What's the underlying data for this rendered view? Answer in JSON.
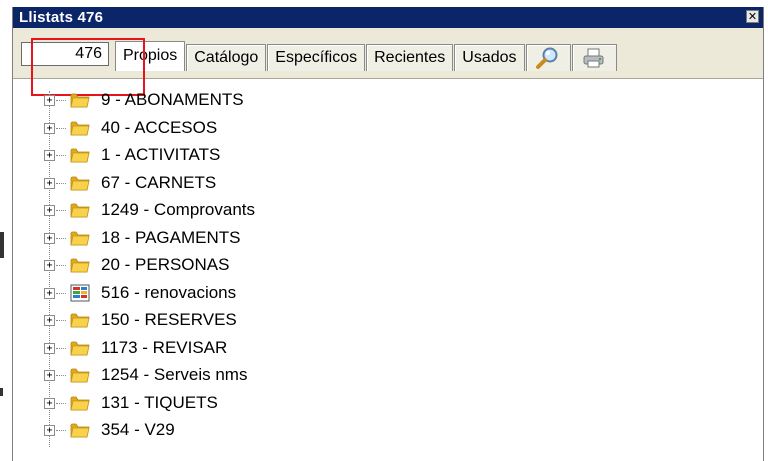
{
  "window": {
    "title": "Llistats 476",
    "close_symbol": "✕"
  },
  "toolbar": {
    "count_value": "476",
    "tabs": [
      {
        "label": "Propios",
        "active": true
      },
      {
        "label": "Catálogo",
        "active": false
      },
      {
        "label": "Específicos",
        "active": false
      },
      {
        "label": "Recientes",
        "active": false
      },
      {
        "label": "Usados",
        "active": false
      }
    ],
    "icon_tabs": [
      "search-icon",
      "printer-icon"
    ]
  },
  "tree": {
    "items": [
      {
        "label": "9 - ABONAMENTS",
        "icon": "folder-icon"
      },
      {
        "label": "40 - ACCESOS",
        "icon": "folder-icon"
      },
      {
        "label": "1 - ACTIVITATS",
        "icon": "folder-icon"
      },
      {
        "label": "67 - CARNETS",
        "icon": "folder-icon"
      },
      {
        "label": "1249 - Comprovants",
        "icon": "folder-icon"
      },
      {
        "label": "18 - PAGAMENTS",
        "icon": "folder-icon"
      },
      {
        "label": "20 - PERSONAS",
        "icon": "folder-icon"
      },
      {
        "label": "516 - renovacions",
        "icon": "report-icon"
      },
      {
        "label": "150 - RESERVES",
        "icon": "folder-icon"
      },
      {
        "label": "1173 - REVISAR",
        "icon": "folder-icon"
      },
      {
        "label": "1254 - Serveis nms",
        "icon": "folder-icon"
      },
      {
        "label": "131 - TIQUETS",
        "icon": "folder-icon"
      },
      {
        "label": "354 - V29",
        "icon": "folder-icon"
      }
    ],
    "expander_symbol": "+"
  },
  "colors": {
    "titlebar": "#0b2569",
    "highlight": "#e8141c",
    "folder": "#f4c531"
  }
}
